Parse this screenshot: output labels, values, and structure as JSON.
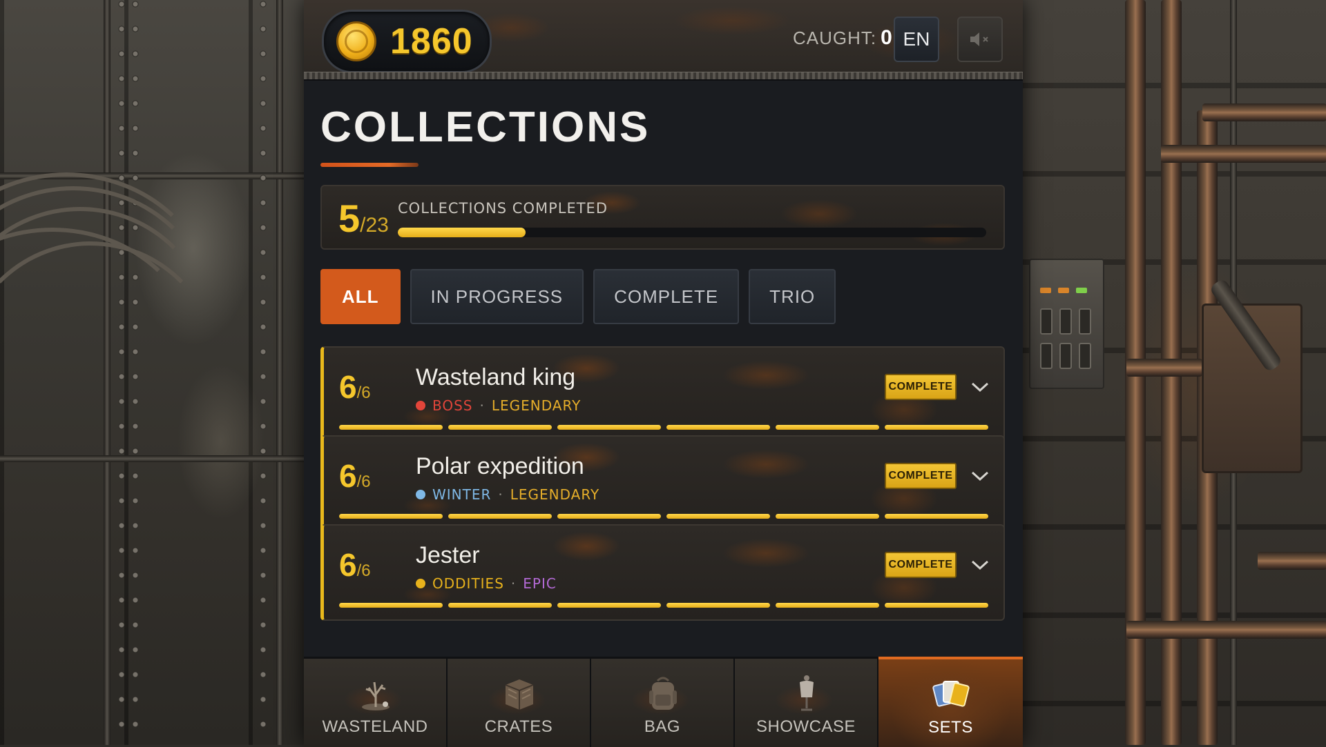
{
  "header": {
    "coins": "1860",
    "caught_label": "CAUGHT:",
    "caught_value": "0",
    "language": "EN",
    "sound_icon": "speaker-muted-icon"
  },
  "page": {
    "title": "COLLECTIONS"
  },
  "summary": {
    "completed": "5",
    "total": "/23",
    "label": "COLLECTIONS COMPLETED",
    "progress": 0.217
  },
  "filters": [
    {
      "label": "ALL",
      "active": true
    },
    {
      "label": "IN PROGRESS",
      "active": false
    },
    {
      "label": "COMPLETE",
      "active": false
    },
    {
      "label": "TRIO",
      "active": false
    }
  ],
  "collections": [
    {
      "count": "6",
      "total": "/6",
      "name": "Wasteland king",
      "category": "BOSS",
      "category_color": "#e2453a",
      "rarity": "LEGENDARY",
      "rarity_color": "#e6ae2a",
      "badge": "COMPLETE",
      "segments": 6,
      "filled": 6
    },
    {
      "count": "6",
      "total": "/6",
      "name": "Polar expedition",
      "category": "WINTER",
      "category_color": "#7fb8e6",
      "rarity": "LEGENDARY",
      "rarity_color": "#e6ae2a",
      "badge": "COMPLETE",
      "segments": 6,
      "filled": 6
    },
    {
      "count": "6",
      "total": "/6",
      "name": "Jester",
      "category": "ODDITIES",
      "category_color": "#e8b21c",
      "rarity": "EPIC",
      "rarity_color": "#b46ad6",
      "badge": "COMPLETE",
      "segments": 6,
      "filled": 6
    }
  ],
  "nav": [
    {
      "label": "WASTELAND",
      "icon": "dead-tree-icon",
      "active": false
    },
    {
      "label": "CRATES",
      "icon": "crate-icon",
      "active": false
    },
    {
      "label": "BAG",
      "icon": "backpack-icon",
      "active": false
    },
    {
      "label": "SHOWCASE",
      "icon": "mannequin-icon",
      "active": false
    },
    {
      "label": "SETS",
      "icon": "cards-icon",
      "active": true
    }
  ],
  "colors": {
    "accent_orange": "#d35a1c",
    "gold": "#f5c72c",
    "panel_bg": "#1a1c20"
  }
}
